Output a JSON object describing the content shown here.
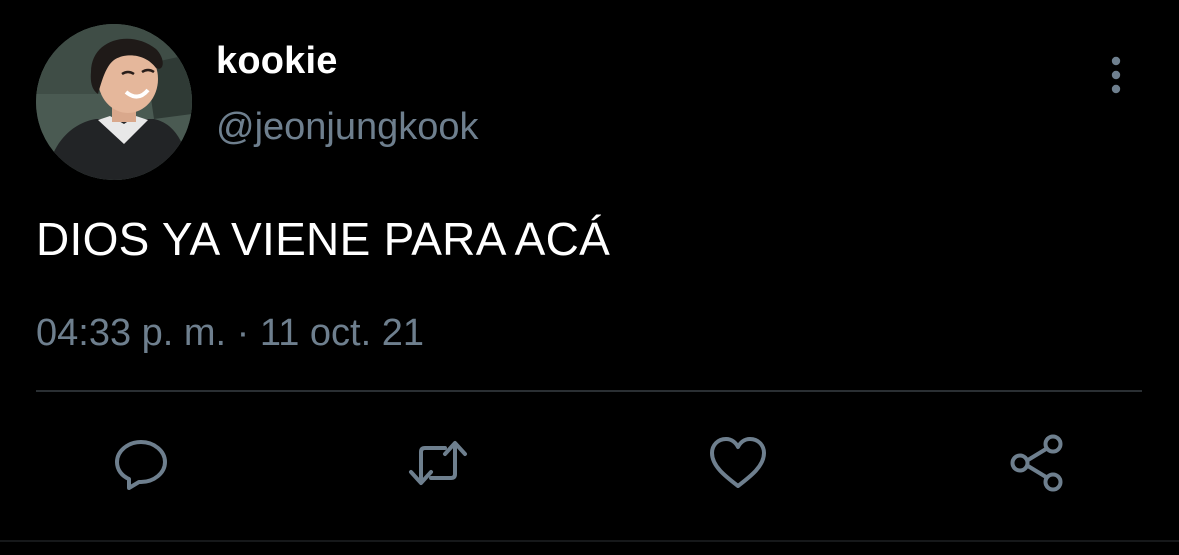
{
  "tweet": {
    "author": {
      "display_name": "kookie",
      "handle": "@jeonjungkook"
    },
    "text": "DIOS YA VIENE PARA ACÁ",
    "timestamp": "04:33 p. m. · 11 oct. 21"
  },
  "actions": [
    {
      "name": "reply",
      "icon": "reply-icon"
    },
    {
      "name": "retweet",
      "icon": "retweet-icon"
    },
    {
      "name": "like",
      "icon": "heart-icon"
    },
    {
      "name": "share",
      "icon": "share-icon"
    }
  ],
  "colors": {
    "background": "#000000",
    "primary_text": "#ffffff",
    "secondary_text": "#6e7f8e",
    "divider": "#2a2f33"
  }
}
